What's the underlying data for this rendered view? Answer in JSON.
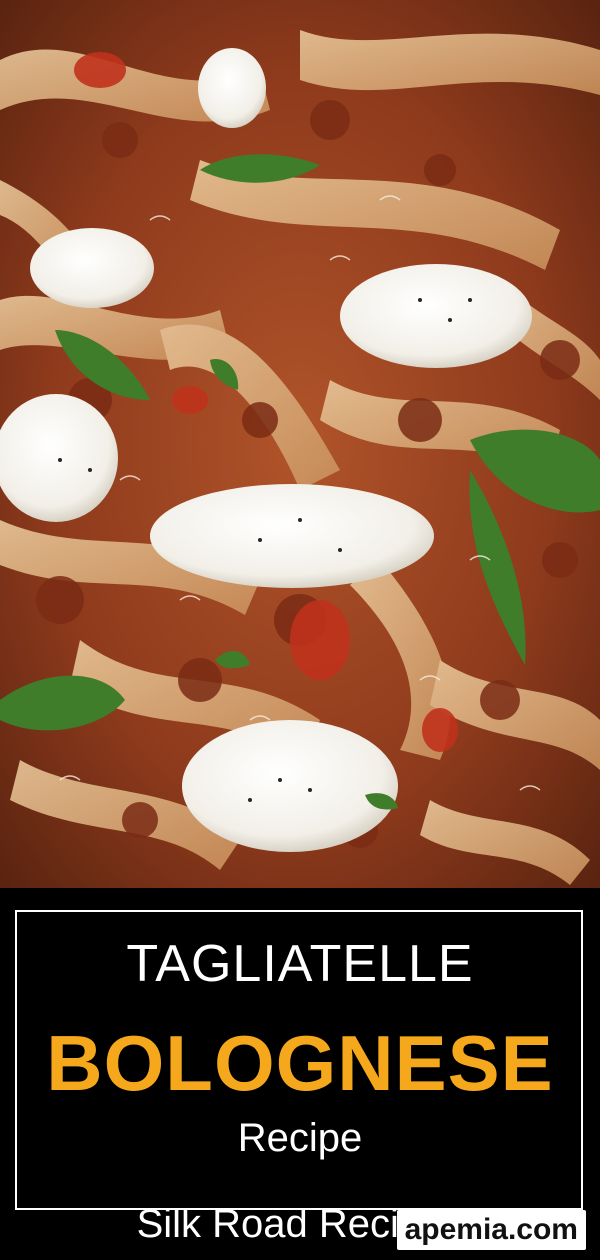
{
  "photo": {
    "description_icon": "pasta-photo"
  },
  "title": {
    "line1": "TAGLIATELLE",
    "line2": "BOLOGNESE",
    "line3": "Recipe",
    "accent_color": "#f5a81c"
  },
  "brand": {
    "name": "Silk Road Recipes"
  },
  "watermark": {
    "text": "apemia.com"
  }
}
